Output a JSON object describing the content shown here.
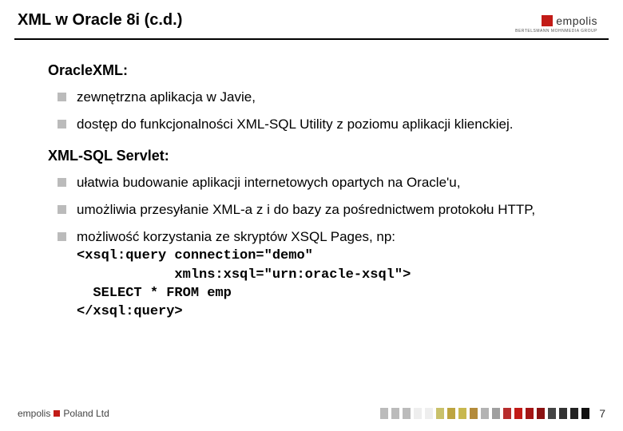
{
  "header": {
    "title": "XML w Oracle 8i (c.d.)",
    "logo_text": "empolis",
    "logo_sub": "BERTELSMANN MOHNMEDIA GROUP"
  },
  "sections": [
    {
      "title": "OracleXML:",
      "items": [
        {
          "text": "zewnętrzna aplikacja w Javie,"
        },
        {
          "text": "dostęp do funkcjonalności XML-SQL Utility z poziomu aplikacji klienckiej."
        }
      ]
    },
    {
      "title": "XML-SQL Servlet:",
      "items": [
        {
          "text": "ułatwia budowanie aplikacji internetowych opartych na Oracle'u,"
        },
        {
          "text": "umożliwia przesyłanie XML-a z i do bazy za pośrednictwem protokołu HTTP,"
        },
        {
          "text": "możliwość korzystania ze skryptów XSQL Pages, np:",
          "code": "<xsql:query connection=\"demo\"\n            xmlns:xsql=\"urn:oracle-xsql\">\n  SELECT * FROM emp\n</xsql:query>"
        }
      ]
    }
  ],
  "footer": {
    "logo_left": "empolis",
    "logo_right": "Poland Ltd",
    "bar_colors": [
      "#bbbbbb",
      "#bbbbbb",
      "#bbbbbb",
      "#eeeeee",
      "#eeeeee",
      "#c9c16a",
      "#bda43f",
      "#c8b84e",
      "#b48b3a",
      "#b3b3b3",
      "#9f9f9f",
      "#b72d2d",
      "#c21b17",
      "#a41515",
      "#8a1111",
      "#444444",
      "#333333",
      "#222222",
      "#111111"
    ],
    "page_number": "7"
  }
}
